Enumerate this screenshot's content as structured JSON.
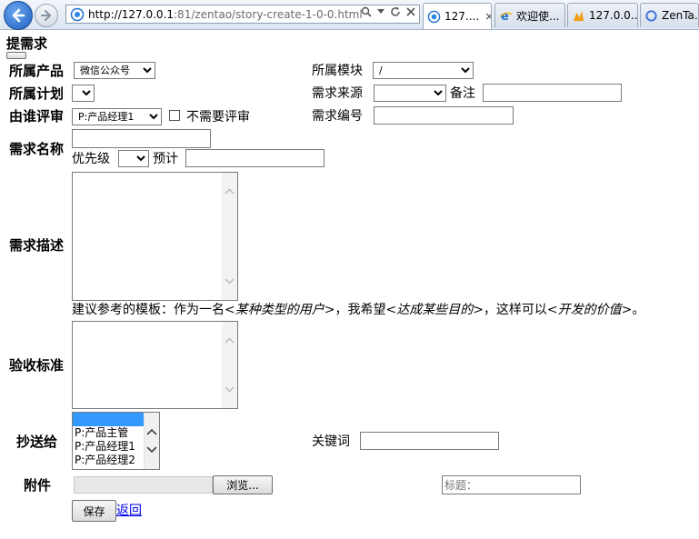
{
  "browser": {
    "url_host": "http://127.0.0.1",
    "url_rest": ":81/zentao/story-create-1-0-0.html",
    "tabs": [
      {
        "label": "127....",
        "active": true
      },
      {
        "label": "欢迎使...",
        "active": false
      },
      {
        "label": "127.0.0...",
        "active": false
      },
      {
        "label": "ZenTa...",
        "active": false
      }
    ],
    "close_glyph": "×"
  },
  "form": {
    "title": "提需求",
    "product": {
      "label": "所属产品",
      "value": "微信公众号"
    },
    "module": {
      "label": "所属模块",
      "value": "/"
    },
    "plan": {
      "label": "所属计划",
      "value": ""
    },
    "source": {
      "label": "需求来源",
      "value": ""
    },
    "note": {
      "label": "备注",
      "value": ""
    },
    "reviewer": {
      "label": "由谁评审",
      "value": "P:产品经理1",
      "no_review_label": "不需要评审"
    },
    "story_no": {
      "label": "需求编号",
      "value": ""
    },
    "name": {
      "label": "需求名称",
      "value": ""
    },
    "priority": {
      "label": "优先级",
      "value": ""
    },
    "estimate": {
      "label": "预计",
      "value": ""
    },
    "description": {
      "label": "需求描述"
    },
    "template_hint": {
      "prefix": "建议参考的模板：作为一名<",
      "role": "某种类型的用户",
      "mid1": ">，我希望<",
      "goal": "达成某些目的",
      "mid2": ">，这样可以<",
      "value": "开发的价值",
      "suffix": ">。"
    },
    "acceptance": {
      "label": "验收标准"
    },
    "mailto": {
      "label": "抄送给",
      "options": [
        "",
        "P:产品主管",
        "P:产品经理1",
        "P:产品经理2"
      ]
    },
    "keywords": {
      "label": "关键词",
      "value": ""
    },
    "attachment": {
      "label": "附件",
      "browse_label": "浏览...",
      "title_placeholder": "标题："
    },
    "save_label": "保存",
    "back_label": "返回"
  }
}
